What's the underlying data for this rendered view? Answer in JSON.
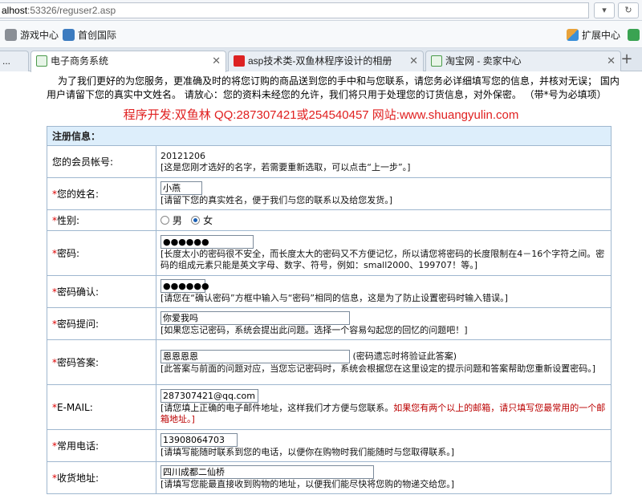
{
  "browser": {
    "url_host": "alhost",
    "url_path": ":53326/reguser2.asp",
    "bookmarks": [
      {
        "label": "游戏中心",
        "icon": "gamepad-icon"
      },
      {
        "label": "首创国际",
        "icon": "bookmark-icon"
      }
    ],
    "extension_label": "扩展中心",
    "tabs": [
      {
        "label": "...",
        "active": false
      },
      {
        "label": "电子商务系统",
        "active": true
      },
      {
        "label": "asp技术类-双鱼林程序设计的相册",
        "active": false
      },
      {
        "label": "淘宝网 - 卖家中心",
        "active": false
      }
    ],
    "colors": {
      "accent": "#1a5fb4",
      "required": "#dd0000",
      "table_border": "#9fb7cf",
      "header_bg": "#ddeefb"
    }
  },
  "page": {
    "intro": "为了我们更好的为您服务，更准确及时的将您订购的商品送到您的手中和与您联系，请您务必详细填写您的信息，并核对无误； 国内用户请留下您的真实中文姓名。 请放心：您的资料未经您的允许，我们将只用于处理您的订货信息，对外保密。 （带*号为必填项）",
    "developer": "程序开发:双鱼林 QQ:287307421或254540457 网站:www.shuangyulin.com",
    "form_title": "注册信息：",
    "fields": {
      "account": {
        "label": "您的会员帐号:",
        "value": "20121206",
        "hint": "[这是您刚才选好的名字，若需要重新选取，可以点击“上一步”。]"
      },
      "name": {
        "label": "您的姓名:",
        "value": "小燕",
        "hint": "[请留下您的真实姓名，便于我们与您的联系以及给您发货。]"
      },
      "gender": {
        "label": "性别:",
        "options": [
          "男",
          "女"
        ],
        "selected": "女"
      },
      "password": {
        "label": "密码:",
        "value": "●●●●●●",
        "hint": "[长度太小的密码很不安全，而长度太大的密码又不方便记忆，所以请您将密码的长度限制在4－16个字符之间。密码的组成元素只能是英文字母、数字、符号，例如：small2000、199707！等。]"
      },
      "password_confirm": {
        "label": "密码确认:",
        "value": "●●●●●●",
        "hint": "[请您在“确认密码”方框中输入与“密码”相同的信息，这是为了防止设置密码时输入错误。]"
      },
      "question": {
        "label": "密码提问:",
        "value": "你爱我吗",
        "hint": "[如果您忘记密码，系统会提出此问题。选择一个容易勾起您的回忆的问题吧！]"
      },
      "answer": {
        "label": "密码答案:",
        "value": "恩恩恩恩",
        "side_note": "(密码遗忘时将验证此答案)",
        "hint": "[此答案与前面的问题对应，当您忘记密码时，系统会根据您在这里设定的提示问题和答案帮助您重新设置密码。]"
      },
      "email": {
        "label": "E-MAIL:",
        "value": "287307421@qq.com",
        "hint": "[请您填上正确的电子邮件地址，这样我们才方便与您联系。",
        "hint_red": "如果您有两个以上的邮箱，请只填写您最常用的一个邮箱地址。]"
      },
      "phone": {
        "label": "常用电话:",
        "value": "13908064703",
        "hint": "[请填写能随时联系到您的电话，以便你在购物时我们能随时与您取得联系。]"
      },
      "address": {
        "label": "收货地址:",
        "value": "四川成都二仙桥",
        "hint": "[请填写您能最直接收到购物的地址，以便我们能尽快将您购的物递交给您。]"
      }
    },
    "required_marker": "*"
  }
}
